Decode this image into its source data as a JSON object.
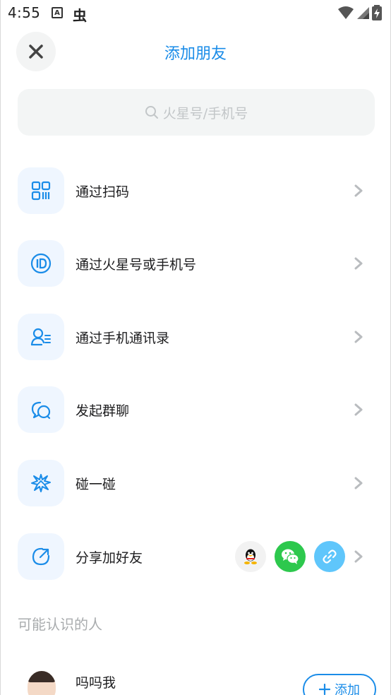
{
  "status_bar": {
    "time": "4:55",
    "badge_a": "A",
    "bug_glyph": "虫"
  },
  "header": {
    "title": "添加朋友"
  },
  "search": {
    "placeholder": "火星号/手机号"
  },
  "menu": [
    {
      "label": "通过扫码",
      "icon": "qr-code-icon"
    },
    {
      "label": "通过火星号或手机号",
      "icon": "id-icon"
    },
    {
      "label": "通过手机通讯录",
      "icon": "contacts-icon"
    },
    {
      "label": "发起群聊",
      "icon": "group-chat-icon"
    },
    {
      "label": "碰一碰",
      "icon": "bump-icon"
    },
    {
      "label": "分享加好友",
      "icon": "share-icon"
    }
  ],
  "share_targets": [
    "qq-icon",
    "wechat-icon",
    "link-icon"
  ],
  "suggestions": {
    "title": "可能认识的人",
    "people": [
      {
        "name": "吗吗我",
        "add_label": "添加"
      }
    ]
  },
  "colors": {
    "accent": "#1a8ce8",
    "icon_bg": "#eff6ff",
    "wechat": "#2dc84d",
    "link": "#5fc6fb"
  }
}
